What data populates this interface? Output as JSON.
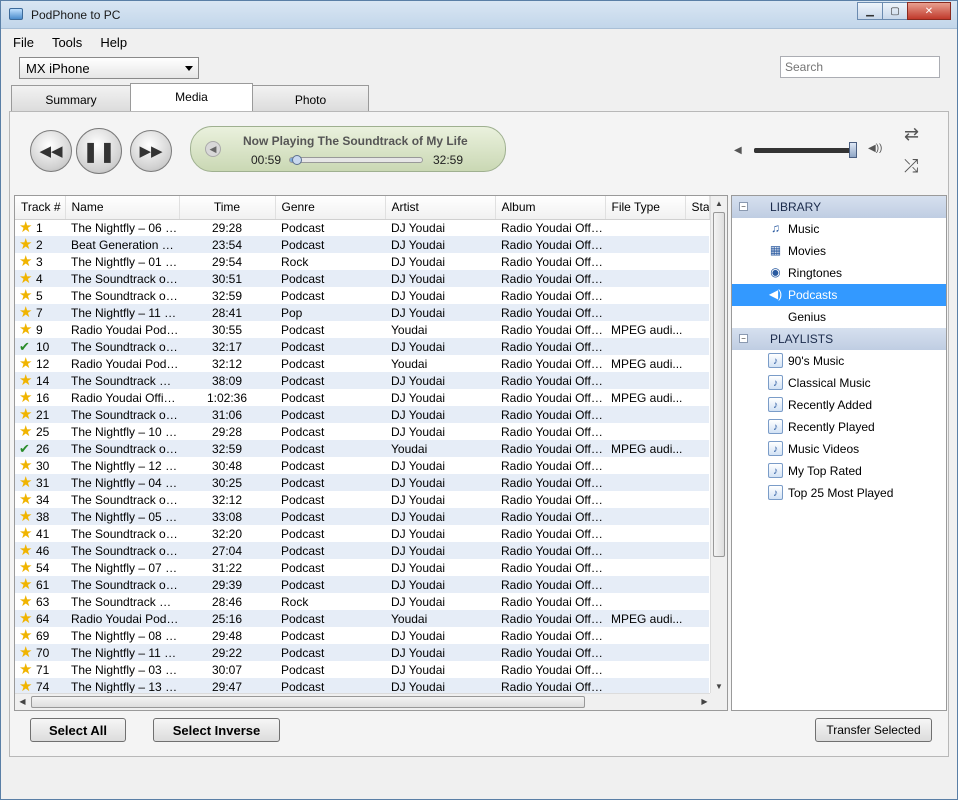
{
  "window": {
    "title": "PodPhone to PC"
  },
  "menu": {
    "file": "File",
    "tools": "Tools",
    "help": "Help"
  },
  "device": {
    "selected": "MX iPhone"
  },
  "search": {
    "placeholder": "Search"
  },
  "tabs": [
    {
      "label": "Summary"
    },
    {
      "label": "Media"
    },
    {
      "label": "Photo"
    }
  ],
  "player": {
    "now_playing": "Now Playing The Soundtrack of My Life",
    "current_time": "00:59",
    "total_time": "32:59",
    "progress": 0.03,
    "volume": 0.97
  },
  "table": {
    "columns": [
      "Track #",
      "Name",
      "Time",
      "Genre",
      "Artist",
      "Album",
      "File Type",
      "Star"
    ],
    "rows": [
      {
        "status": "star",
        "track": "1",
        "name": "The Nightfly – 06 – ...",
        "time": "29:28",
        "genre": "Podcast",
        "artist": "DJ Youdai",
        "album": "Radio Youdai Offic...",
        "filetype": ""
      },
      {
        "status": "star",
        "track": "2",
        "name": "Beat Generation – ...",
        "time": "23:54",
        "genre": "Podcast",
        "artist": "DJ Youdai",
        "album": "Radio Youdai Offic...",
        "filetype": ""
      },
      {
        "status": "star",
        "track": "3",
        "name": "The Nightfly – 01 – ...",
        "time": "29:54",
        "genre": "Rock",
        "artist": "DJ Youdai",
        "album": "Radio Youdai Offic...",
        "filetype": ""
      },
      {
        "status": "star",
        "track": "4",
        "name": "The Soundtrack of ...",
        "time": "30:51",
        "genre": "Podcast",
        "artist": "DJ Youdai",
        "album": "Radio Youdai Offic...",
        "filetype": ""
      },
      {
        "status": "star",
        "track": "5",
        "name": "The Soundtrack of ...",
        "time": "32:59",
        "genre": "Podcast",
        "artist": "DJ Youdai",
        "album": "Radio Youdai Offic...",
        "filetype": ""
      },
      {
        "status": "star",
        "track": "7",
        "name": "The Nightfly – 11 – ...",
        "time": "28:41",
        "genre": "Pop",
        "artist": "DJ Youdai",
        "album": "Radio Youdai Offic...",
        "filetype": ""
      },
      {
        "status": "star",
        "track": "9",
        "name": "Radio Youdai Podc...",
        "time": "30:55",
        "genre": "Podcast",
        "artist": "Youdai",
        "album": "Radio Youdai Offic...",
        "filetype": "MPEG audi..."
      },
      {
        "status": "check",
        "track": "10",
        "name": "The Soundtrack of ...",
        "time": "32:17",
        "genre": "Podcast",
        "artist": "DJ Youdai",
        "album": "Radio Youdai Offic...",
        "filetype": ""
      },
      {
        "status": "star",
        "track": "12",
        "name": "Radio Youdai Podc...",
        "time": "32:12",
        "genre": "Podcast",
        "artist": "Youdai",
        "album": "Radio Youdai Offic...",
        "filetype": "MPEG audi..."
      },
      {
        "status": "star",
        "track": "14",
        "name": "The Soundtrack Of...",
        "time": "38:09",
        "genre": "Podcast",
        "artist": "DJ Youdai",
        "album": "Radio Youdai Offic...",
        "filetype": ""
      },
      {
        "status": "star",
        "track": "16",
        "name": "Radio Youdai Offici...",
        "time": "1:02:36",
        "genre": "Podcast",
        "artist": "DJ Youdai",
        "album": "Radio Youdai Offic...",
        "filetype": "MPEG audi..."
      },
      {
        "status": "star",
        "track": "21",
        "name": "The Soundtrack of ...",
        "time": "31:06",
        "genre": "Podcast",
        "artist": "DJ Youdai",
        "album": "Radio Youdai Offic...",
        "filetype": ""
      },
      {
        "status": "star",
        "track": "25",
        "name": "The Nightfly – 10 – ...",
        "time": "29:28",
        "genre": "Podcast",
        "artist": "DJ Youdai",
        "album": "Radio Youdai Offic...",
        "filetype": ""
      },
      {
        "status": "check",
        "track": "26",
        "name": "The Soundtrack of ...",
        "time": "32:59",
        "genre": "Podcast",
        "artist": "Youdai",
        "album": "Radio Youdai Offic...",
        "filetype": "MPEG audi..."
      },
      {
        "status": "star",
        "track": "30",
        "name": "The Nightfly – 12 – ...",
        "time": "30:48",
        "genre": "Podcast",
        "artist": "DJ Youdai",
        "album": "Radio Youdai Offic...",
        "filetype": ""
      },
      {
        "status": "star",
        "track": "31",
        "name": "The Nightfly – 04 – ...",
        "time": "30:25",
        "genre": "Podcast",
        "artist": "DJ Youdai",
        "album": "Radio Youdai Offic...",
        "filetype": ""
      },
      {
        "status": "star",
        "track": "34",
        "name": "The Soundtrack of ...",
        "time": "32:12",
        "genre": "Podcast",
        "artist": "DJ Youdai",
        "album": "Radio Youdai Offic...",
        "filetype": ""
      },
      {
        "status": "star",
        "track": "38",
        "name": "The Nightfly – 05 – ...",
        "time": "33:08",
        "genre": "Podcast",
        "artist": "DJ Youdai",
        "album": "Radio Youdai Offic...",
        "filetype": ""
      },
      {
        "status": "star",
        "track": "41",
        "name": "The Soundtrack of ...",
        "time": "32:20",
        "genre": "Podcast",
        "artist": "DJ Youdai",
        "album": "Radio Youdai Offic...",
        "filetype": ""
      },
      {
        "status": "star",
        "track": "46",
        "name": "The Soundtrack of ...",
        "time": "27:04",
        "genre": "Podcast",
        "artist": "DJ Youdai",
        "album": "Radio Youdai Offic...",
        "filetype": ""
      },
      {
        "status": "star",
        "track": "54",
        "name": "The Nightfly – 07 – ...",
        "time": "31:22",
        "genre": "Podcast",
        "artist": "DJ Youdai",
        "album": "Radio Youdai Offic...",
        "filetype": ""
      },
      {
        "status": "star",
        "track": "61",
        "name": "The Soundtrack of ...",
        "time": "29:39",
        "genre": "Podcast",
        "artist": "DJ Youdai",
        "album": "Radio Youdai Offic...",
        "filetype": ""
      },
      {
        "status": "star",
        "track": "63",
        "name": "The Soundtrack Of...",
        "time": "28:46",
        "genre": "Rock",
        "artist": "DJ Youdai",
        "album": "Radio Youdai Offic...",
        "filetype": ""
      },
      {
        "status": "star",
        "track": "64",
        "name": "Radio Youdai Podc...",
        "time": "25:16",
        "genre": "Podcast",
        "artist": "Youdai",
        "album": "Radio Youdai Offic...",
        "filetype": "MPEG audi..."
      },
      {
        "status": "star",
        "track": "69",
        "name": "The Nightfly – 08 – ...",
        "time": "29:48",
        "genre": "Podcast",
        "artist": "DJ Youdai",
        "album": "Radio Youdai Offic...",
        "filetype": ""
      },
      {
        "status": "star",
        "track": "70",
        "name": "The Nightfly – 11 – ...",
        "time": "29:22",
        "genre": "Podcast",
        "artist": "DJ Youdai",
        "album": "Radio Youdai Offic...",
        "filetype": ""
      },
      {
        "status": "star",
        "track": "71",
        "name": "The Nightfly – 03 – ...",
        "time": "30:07",
        "genre": "Podcast",
        "artist": "DJ Youdai",
        "album": "Radio Youdai Offic...",
        "filetype": ""
      },
      {
        "status": "star",
        "track": "74",
        "name": "The Nightfly – 13 – ...",
        "time": "29:47",
        "genre": "Podcast",
        "artist": "DJ Youdai",
        "album": "Radio Youdai Offic...",
        "filetype": ""
      }
    ]
  },
  "library": {
    "header": "LIBRARY",
    "items": [
      {
        "label": "Music",
        "icon": "music-note-icon",
        "selected": false
      },
      {
        "label": "Movies",
        "icon": "film-icon",
        "selected": false
      },
      {
        "label": "Ringtones",
        "icon": "bell-icon",
        "selected": false
      },
      {
        "label": "Podcasts",
        "icon": "podcast-icon",
        "selected": true
      },
      {
        "label": "Genius",
        "icon": "",
        "selected": false
      }
    ]
  },
  "playlists": {
    "header": "PLAYLISTS",
    "items": [
      {
        "label": "90's Music"
      },
      {
        "label": "Classical Music"
      },
      {
        "label": "Recently Added"
      },
      {
        "label": "Recently Played"
      },
      {
        "label": "Music Videos"
      },
      {
        "label": "My Top Rated"
      },
      {
        "label": "Top 25 Most Played"
      }
    ]
  },
  "buttons": {
    "select_all": "Select All",
    "select_inverse": "Select Inverse",
    "transfer_selected": "Transfer Selected"
  }
}
